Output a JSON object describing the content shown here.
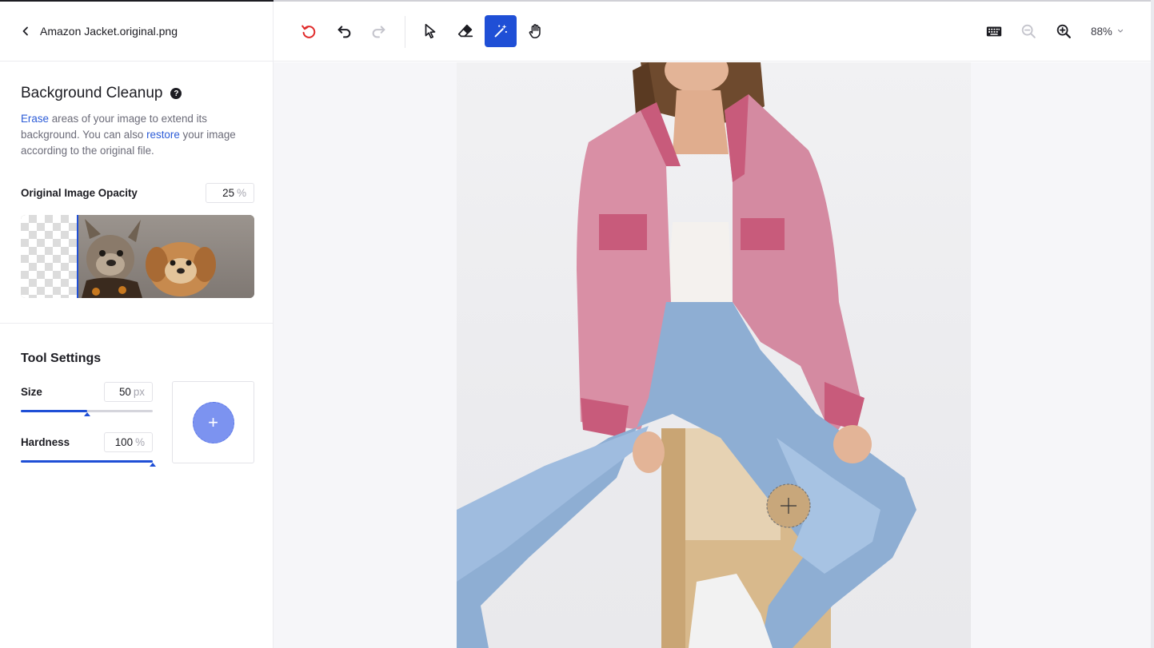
{
  "header": {
    "filename": "Amazon Jacket.original.png"
  },
  "cleanup": {
    "title": "Background Cleanup",
    "desc_word1": "Erase",
    "desc_part1": " areas of your image to extend its background. You can also ",
    "desc_word2": "restore",
    "desc_part2": " your image according to the original file.",
    "opacity_label": "Original Image Opacity",
    "opacity_value": "25",
    "opacity_unit": "%"
  },
  "tool_settings": {
    "title": "Tool Settings",
    "size_label": "Size",
    "size_value": "50",
    "size_unit": "px",
    "size_fraction": 0.5,
    "hardness_label": "Hardness",
    "hardness_value": "100",
    "hardness_unit": "%",
    "hardness_fraction": 1.0
  },
  "toolbar": {
    "zoom": "88%",
    "active_tool": "magic-wand",
    "accent_color": "#1f4fd6",
    "reset_color": "#e02b2b"
  }
}
